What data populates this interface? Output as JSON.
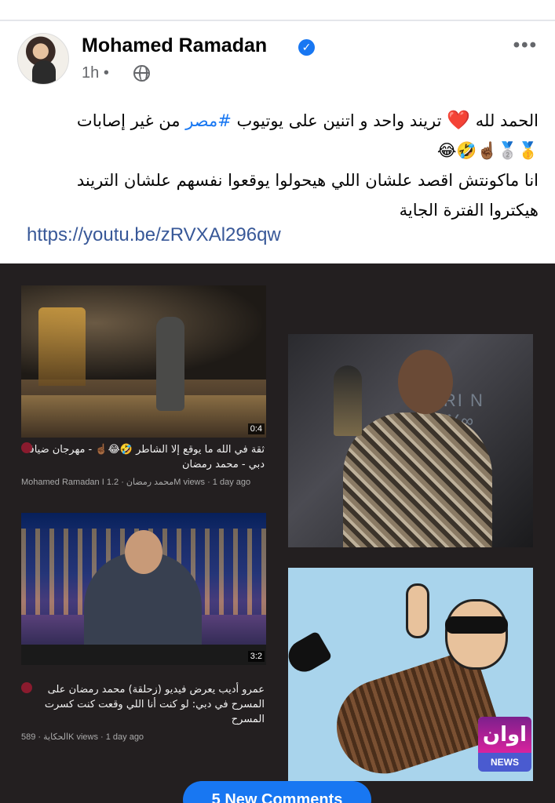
{
  "post": {
    "author": "Mohamed Ramadan",
    "time": "1h",
    "separator": "•",
    "more_label": "•••",
    "text_line1_a": "الحمد لله",
    "text_heart": "❤️",
    "text_line1_b": "تريند واحد و اتنين على يوتيوب",
    "text_hashtag": "#مصر",
    "text_line1_c": "من غير إصابات",
    "text_line2": "🥇🥈☝🏾🤣😂",
    "text_line3": "انا ماكونتش اقصد علشان اللي هيحولوا يوقعوا نفسهم علشان التريند",
    "text_line4": "هيكتروا الفترة الجاية",
    "link": "https://youtu.be/zRVXAl296qw"
  },
  "videos": [
    {
      "title": "ثقة في الله ما يوقع إلا الشاطر 🤣😂☝🏾 - مهرجان ضيافة دبي - محمد رمضان",
      "channel": "Mohamed Ramadan I محمد رمضان",
      "views": "1.2M views",
      "age": "1 day ago",
      "duration": "0:4"
    },
    {
      "title": "عمرو أديب يعرض فيديو (زحلقة) محمد رمضان على المسرح في دبي: لو كنت أنا اللي وقعت كنت كسرت المسرح",
      "channel": "الحكاية",
      "views": "589K views",
      "age": "1 day ago",
      "duration": "3:2"
    }
  ],
  "photo_banner": "URI   N   ITY∞",
  "news_logo": {
    "top": "اوان",
    "bottom": "NEWS"
  },
  "new_comments_button": "5 New Comments",
  "colors": {
    "brand_blue": "#1877f2",
    "link_blue": "#385898",
    "media_bg": "#231f20"
  },
  "icons": [
    "verified-icon",
    "globe-icon",
    "more-icon"
  ]
}
